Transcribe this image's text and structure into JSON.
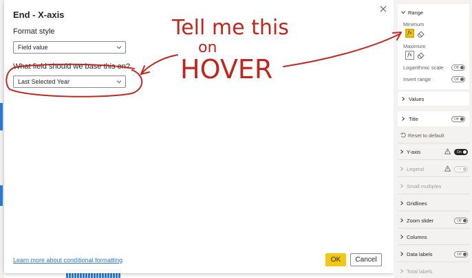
{
  "dialog": {
    "title": "End - X-axis",
    "format_style_label": "Format style",
    "format_style_value": "Field value",
    "base_field_label": "What field should we base this on?",
    "base_field_value": "Last Selected Year",
    "learn_link": "Learn more about conditional formatting",
    "ok_label": "OK",
    "cancel_label": "Cancel"
  },
  "pane": {
    "range_label": "Range",
    "minimum_label": "Minimum",
    "maximum_label": "Maximum",
    "fx_label": "fx",
    "log_scale_label": "Logarithmic scale",
    "invert_range_label": "Invert range",
    "values_label": "Values",
    "title_label": "Title",
    "reset_label": "Reset to default",
    "yaxis_label": "Y-axis",
    "legend_label": "Legend",
    "small_multiples_label": "Small multiples",
    "gridlines_label": "Gridlines",
    "zoom_slider_label": "Zoom slider",
    "columns_label": "Columns",
    "data_labels_label": "Data labels",
    "total_labels_label": "Total labels",
    "toggle_off": "Off",
    "toggle_on": "On"
  },
  "annotation": {
    "line1": "Tell me this",
    "line2": "on",
    "line3": "HOVER",
    "color": "#c0261b"
  },
  "colors": {
    "accent_yellow": "#f2c811",
    "link_blue": "#2d7ac7",
    "annotation_red": "#c0261b"
  },
  "icons": [
    "close-icon",
    "chevron-down-icon",
    "chevron-right-icon",
    "fx-icon",
    "eraser-icon",
    "warning-icon",
    "reset-icon"
  ]
}
